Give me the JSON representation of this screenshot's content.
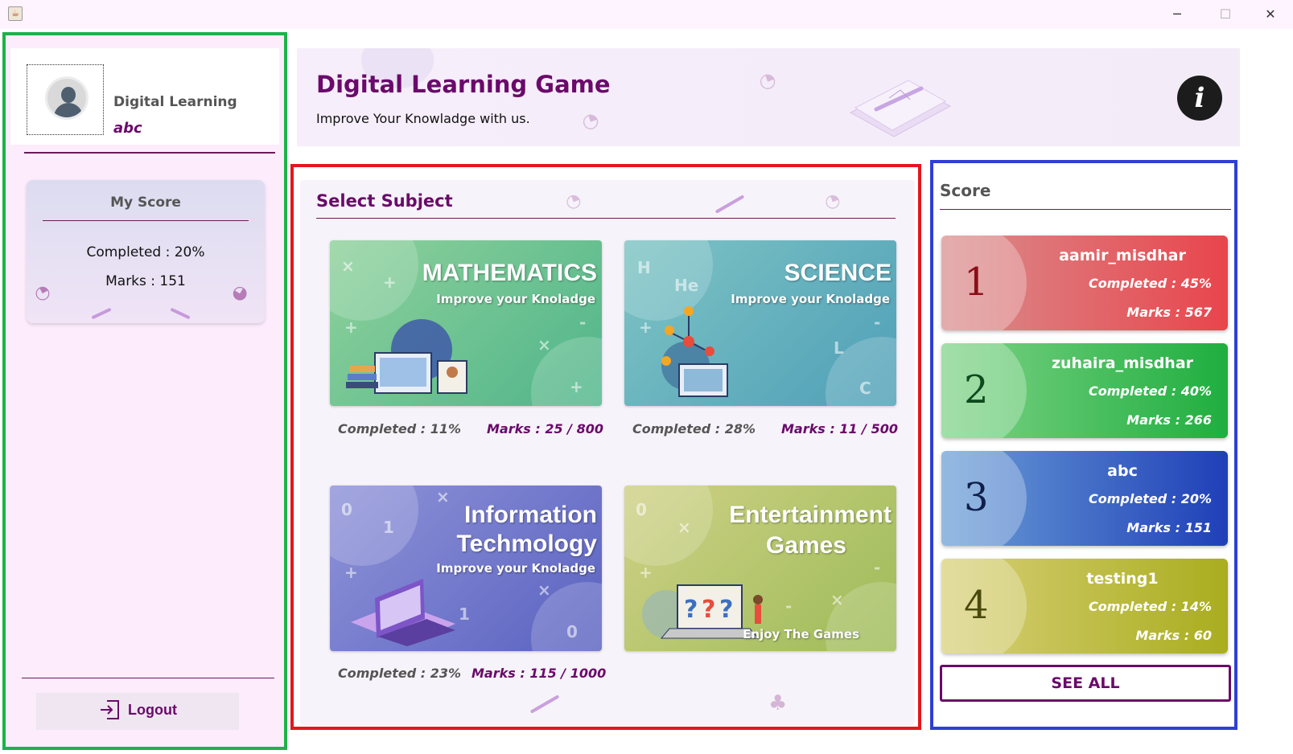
{
  "window": {
    "minimize_symbol": "─",
    "maximize_symbol": "☐",
    "close_symbol": "✕"
  },
  "sidebar": {
    "profile_title": "Digital Learning",
    "username": "abc",
    "my_score": {
      "title": "My Score",
      "completed": "Completed : 20%",
      "marks": "Marks : 151"
    },
    "logout_label": "Logout"
  },
  "banner": {
    "title": "Digital Learning Game",
    "subtitle": "Improve Your Knowladge with us.",
    "info_symbol": "i"
  },
  "subjects": {
    "heading": "Select Subject",
    "items": [
      {
        "title_line1": "MATHEMATICS",
        "title_line2": "",
        "subtitle": "Improve your Knoladge",
        "completed": "Completed : 11%",
        "marks": "Marks : 25 / 800",
        "color_a": "#8fd19b",
        "color_b": "#4fb58a"
      },
      {
        "title_line1": "SCIENCE",
        "title_line2": "",
        "subtitle": "Improve your Knoladge",
        "completed": "Completed : 28%",
        "marks": "Marks : 11 / 500",
        "color_a": "#7ec4c4",
        "color_b": "#4f9fb8"
      },
      {
        "title_line1": "Information",
        "title_line2": "Techmology",
        "subtitle": "Improve your Knoladge",
        "completed": "Completed : 23%",
        "marks": "Marks : 115 / 1000",
        "color_a": "#8f93d8",
        "color_b": "#5a62c0"
      },
      {
        "title_line1": "Entertainment",
        "title_line2": "Games",
        "subtitle": "Enjoy The Games",
        "completed": "",
        "marks": "",
        "color_a": "#cfd186",
        "color_b": "#9dbb58"
      }
    ]
  },
  "score_panel": {
    "title": "Score",
    "entries": [
      {
        "rank": "1",
        "name": "aamir_misdhar",
        "completed": "Completed : 45%",
        "marks": "Marks : 567",
        "color_a": "#d98e8e",
        "color_b": "#e8454c",
        "rank_color": "#8a0f17"
      },
      {
        "rank": "2",
        "name": "zuhaira_misdhar",
        "completed": "Completed : 40%",
        "marks": "Marks : 266",
        "color_a": "#7fd387",
        "color_b": "#1fae3f",
        "rank_color": "#0e4a1d"
      },
      {
        "rank": "3",
        "name": "abc",
        "completed": "Completed : 20%",
        "marks": "Marks : 151",
        "color_a": "#6b9fd6",
        "color_b": "#1f3fb8",
        "rank_color": "#0f1f4a"
      },
      {
        "rank": "4",
        "name": "testing1",
        "completed": "Completed : 14%",
        "marks": "Marks : 60",
        "color_a": "#d8d078",
        "color_b": "#a9ad1e",
        "rank_color": "#4a4a0e"
      }
    ],
    "see_all_label": "SEE ALL"
  },
  "colors": {
    "accent": "#6a0a6a",
    "sidebar_border": "#1db24a",
    "subject_border": "#e4161f",
    "score_border": "#2e3fd4"
  }
}
